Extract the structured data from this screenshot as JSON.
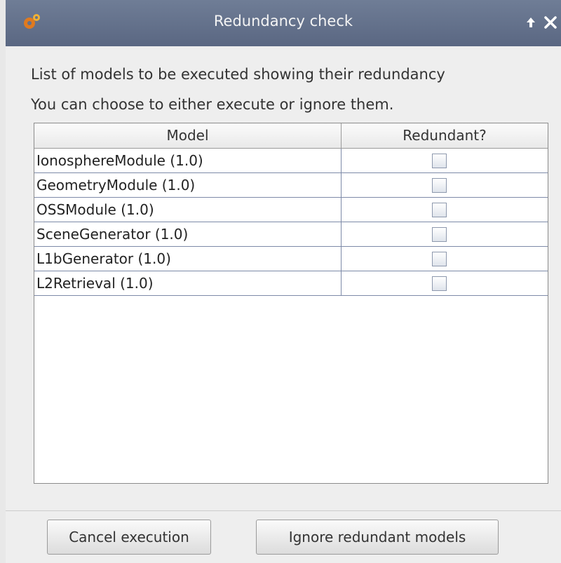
{
  "window": {
    "title": "Redundancy check",
    "icons": {
      "app": "gears-icon",
      "maximize": "arrow-up-icon",
      "close": "close-icon"
    }
  },
  "message": {
    "line1": "List of models to be executed showing their redundancy",
    "line2": "You can choose to either execute or ignore them."
  },
  "table": {
    "columns": [
      "Model",
      "Redundant?"
    ],
    "rows": [
      {
        "model": "IonosphereModule (1.0)",
        "redundant": false
      },
      {
        "model": "GeometryModule (1.0)",
        "redundant": false
      },
      {
        "model": "OSSModule (1.0)",
        "redundant": false
      },
      {
        "model": "SceneGenerator (1.0)",
        "redundant": false
      },
      {
        "model": "L1bGenerator (1.0)",
        "redundant": false
      },
      {
        "model": "L2Retrieval (1.0)",
        "redundant": false
      }
    ]
  },
  "buttons": {
    "cancel": "Cancel execution",
    "ignore": "Ignore redundant models"
  },
  "colors": {
    "titlebar": "#65728c",
    "background": "#eeeeee",
    "grid": "#7d8aa8"
  }
}
